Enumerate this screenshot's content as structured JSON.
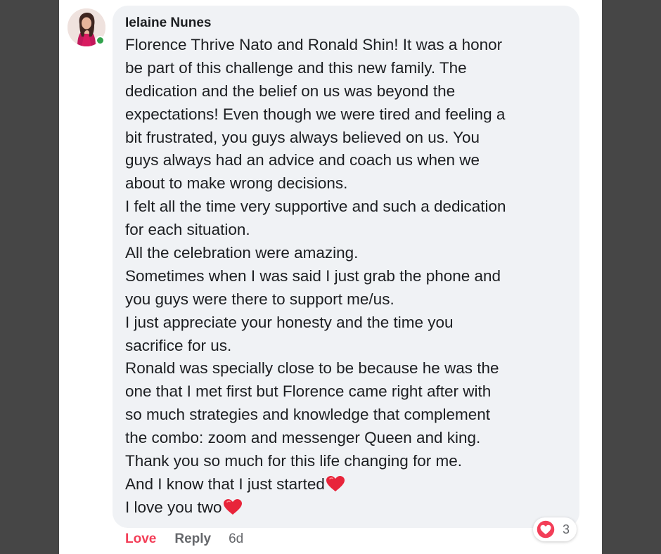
{
  "comment": {
    "author": "Ielaine Nunes",
    "lines": [
      "Florence Thrive Nato and Ronald Shin! It was a honor",
      "be part of this challenge and this new family. The",
      "dedication and the belief on us was beyond the",
      "expectations! Even though we were tired and feeling a",
      "bit frustrated, you guys always believed on us. You",
      "guys always had an advice and coach us when we",
      "about to make wrong decisions.",
      "I felt all the time very supportive and such a dedication",
      "for each situation.",
      "All the celebration were amazing.",
      "Sometimes when I was said I just grab the phone and",
      "you guys were there to support me/us.",
      "I just appreciate your honesty and the time you",
      "sacrifice for us.",
      "Ronald was specially close to be because he was the",
      "one that I met first but Florence came right after with",
      "so much strategies and knowledge that complement",
      "the combo: zoom and messenger Queen and king.",
      "Thank you so much for this life changing for me.",
      "And I know that I just started",
      "I love you two"
    ],
    "emoji_name": "red-heart-emoji"
  },
  "actions": {
    "love_label": "Love",
    "reply_label": "Reply",
    "time": "6d"
  },
  "reactions": {
    "icon": "love-reaction-icon",
    "count": "3"
  },
  "colors": {
    "background": "#464646",
    "bubble": "#f0f2f5",
    "love": "#f33e58",
    "online": "#31a24c",
    "muted": "#65676b"
  }
}
